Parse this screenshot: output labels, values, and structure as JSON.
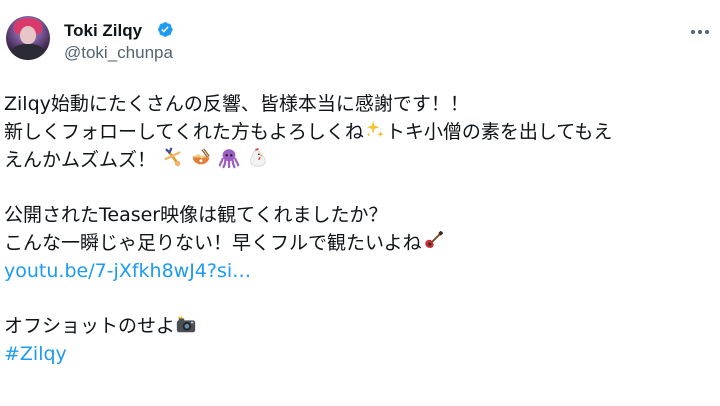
{
  "author": {
    "display_name": "Toki Zilqy",
    "handle": "@toki_chunpa",
    "verified": true
  },
  "icons": {
    "avatar": "profile-avatar",
    "verified": "verified-badge-icon",
    "more": "more-options-icon",
    "sparkles": "sparkles-emoji",
    "cartwheel": "person-cartwheeling-emoji",
    "ramen": "ramen-emoji",
    "octopus": "octopus-emoji",
    "chicken": "rooster-emoji",
    "guitar": "guitar-emoji",
    "camera": "camera-with-flash-emoji"
  },
  "tweet": {
    "line1": "Zilqy始動にたくさんの反響、皆様本当に感謝です！！",
    "line2a": "新しくフォローしてくれた方もよろしくね",
    "line2b": "トキ小僧の素を出してもえ",
    "line3": "えんかムズムズ！",
    "line4": "公開されたTeaser映像は観てくれましたか？",
    "line5": "こんな一瞬じゃ足りない！早くフルで観たいよね",
    "link": "youtu.be/7-jXfkh8wJ4?si…",
    "line6": "オフショットのせよ",
    "hashtag": "#Zilqy"
  },
  "colors": {
    "text": "#0f1419",
    "secondary": "#536471",
    "link": "#1d9bf0",
    "verified": "#1d9bf0"
  }
}
